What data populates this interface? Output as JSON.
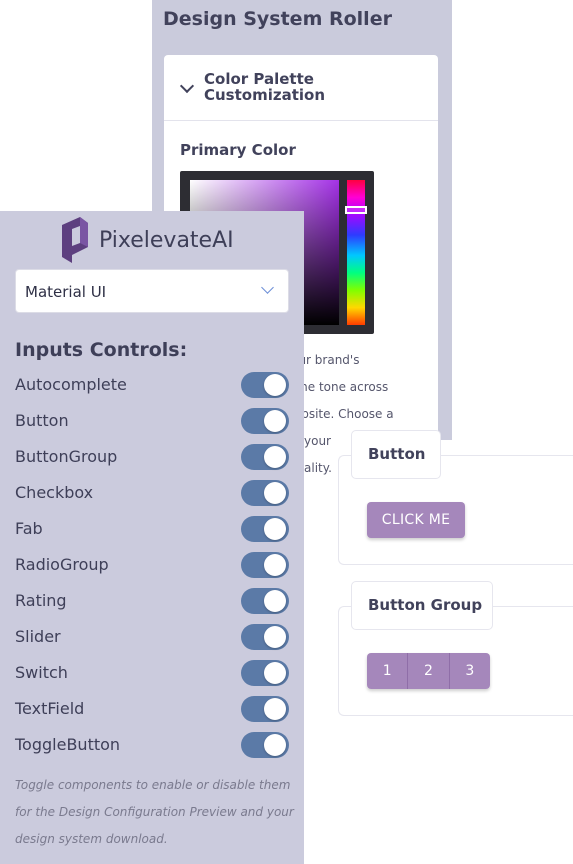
{
  "roller": {
    "title": "Design System Roller",
    "palette": {
      "title": "Color Palette Customization",
      "primary_label": "Primary Color",
      "description_lines": [
        "your brand's",
        "g the tone across",
        "website. Choose a",
        "your",
        "ality."
      ],
      "selected_hue": "#a432e6"
    }
  },
  "preview": {
    "button_section": {
      "title": "Button",
      "button_label": "CLICK ME"
    },
    "group_section": {
      "title": "Button Group",
      "buttons": [
        "1",
        "2",
        "3"
      ]
    },
    "accent_color": "#a587bb"
  },
  "sidebar": {
    "brand_name": "PixelevateAI",
    "brand_icon": "pixelevate-logo-icon",
    "library_select": {
      "value": "Material UI"
    },
    "section_heading": "Inputs Controls:",
    "toggles": [
      {
        "label": "Autocomplete",
        "on": true
      },
      {
        "label": "Button",
        "on": true
      },
      {
        "label": "ButtonGroup",
        "on": true
      },
      {
        "label": "Checkbox",
        "on": true
      },
      {
        "label": "Fab",
        "on": true
      },
      {
        "label": "RadioGroup",
        "on": true
      },
      {
        "label": "Rating",
        "on": true
      },
      {
        "label": "Slider",
        "on": true
      },
      {
        "label": "Switch",
        "on": true
      },
      {
        "label": "TextField",
        "on": true
      },
      {
        "label": "ToggleButton",
        "on": true
      }
    ],
    "help_text": "Toggle components to enable or disable them for the Design Configuration Preview and your design system download.",
    "switch_color": "#5b7aa7"
  }
}
